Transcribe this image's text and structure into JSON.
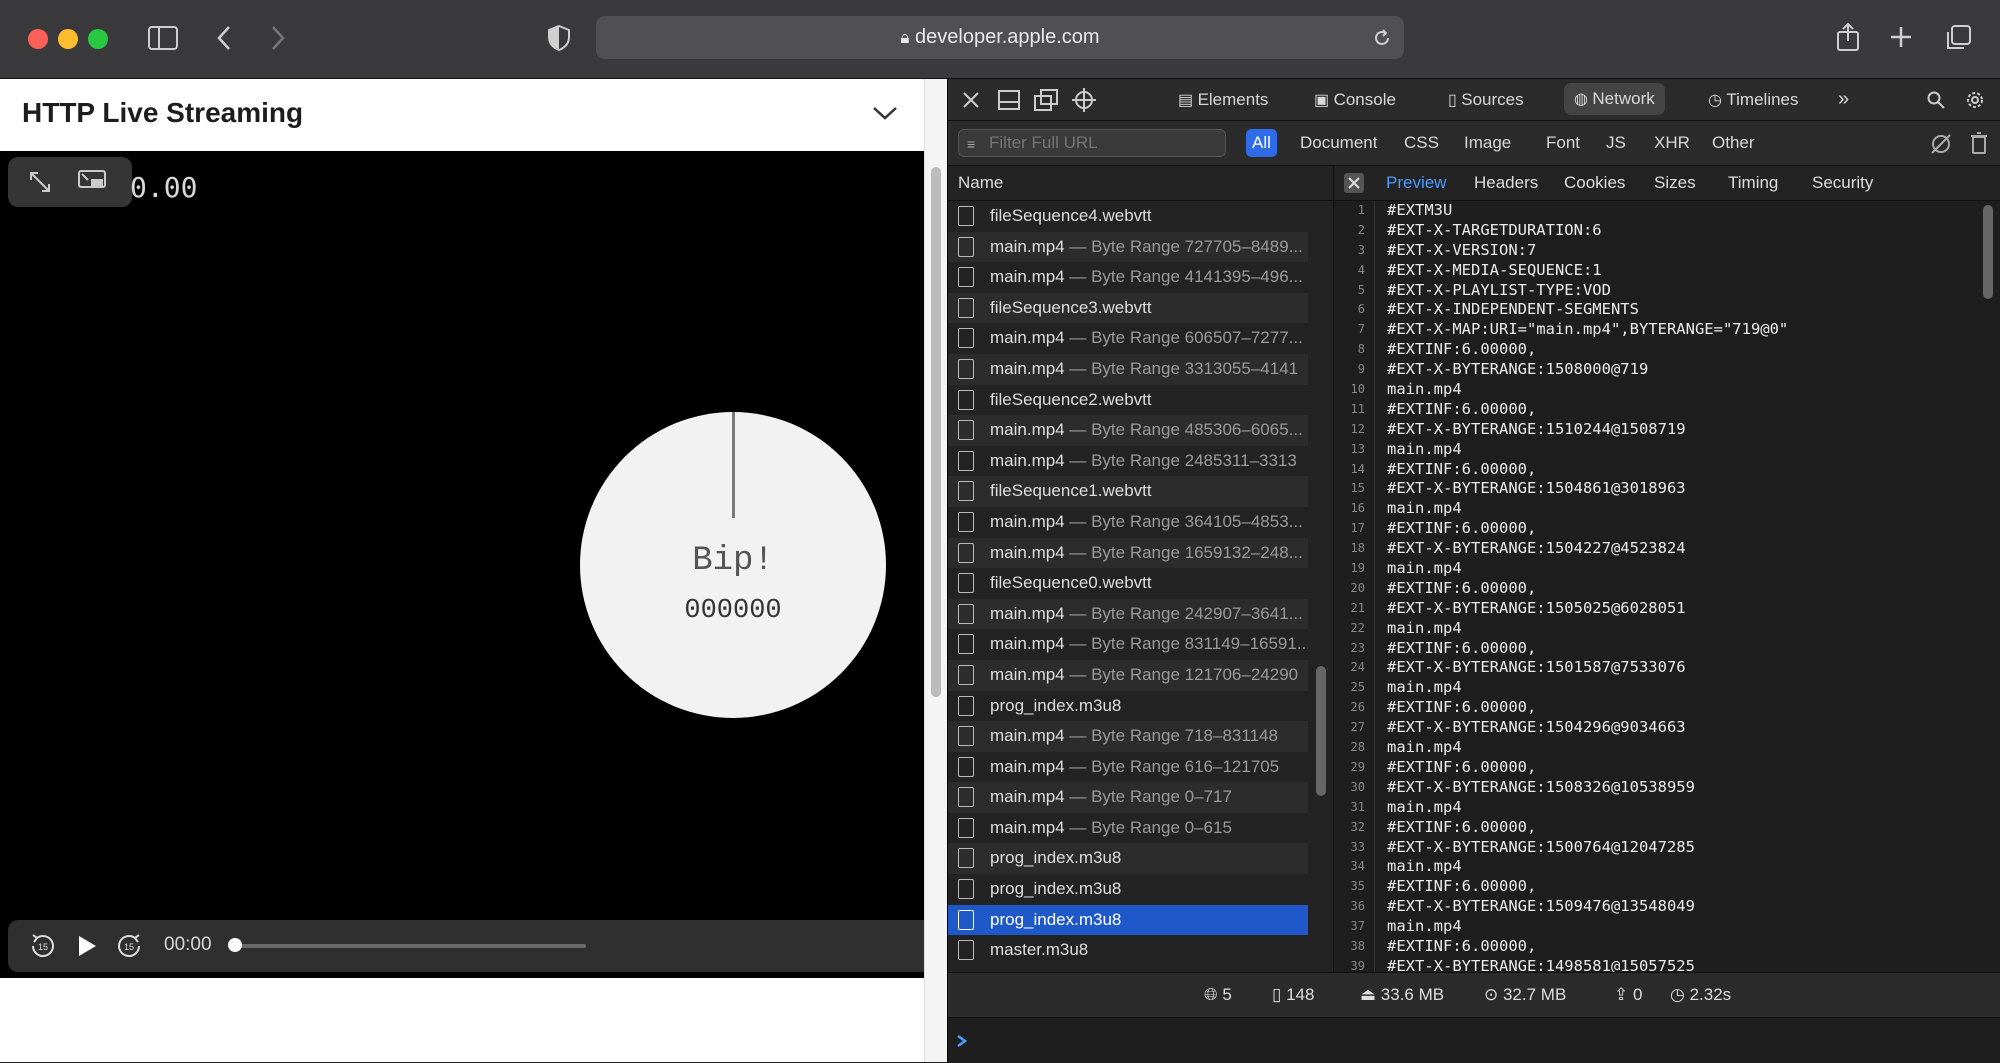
{
  "browser": {
    "url": "developer.apple.com",
    "colors": {
      "close": "#fe5f57",
      "minimize": "#febc2e",
      "zoom": "#28c840"
    }
  },
  "page": {
    "title": "HTTP Live Streaming",
    "video": {
      "top_time": "0.00",
      "bip_text": "Bip!",
      "counter": "000000",
      "current_time": "00:00"
    }
  },
  "devtools": {
    "tabs": [
      "Elements",
      "Console",
      "Sources",
      "Network",
      "Timelines"
    ],
    "active_tab": "Network",
    "filter": {
      "placeholder": "Filter Full URL"
    },
    "types": [
      "All",
      "Document",
      "CSS",
      "Image",
      "Font",
      "JS",
      "XHR",
      "Other"
    ],
    "active_type": "All",
    "name_header": "Name",
    "requests": [
      {
        "name": "fileSequence4.webvtt",
        "range": ""
      },
      {
        "name": "main.mp4",
        "range": " — Byte Range 727705–8489..."
      },
      {
        "name": "main.mp4",
        "range": " — Byte Range 4141395–496..."
      },
      {
        "name": "fileSequence3.webvtt",
        "range": ""
      },
      {
        "name": "main.mp4",
        "range": " — Byte Range 606507–7277..."
      },
      {
        "name": "main.mp4",
        "range": " — Byte Range 3313055–4141"
      },
      {
        "name": "fileSequence2.webvtt",
        "range": ""
      },
      {
        "name": "main.mp4",
        "range": " — Byte Range 485306–6065..."
      },
      {
        "name": "main.mp4",
        "range": " — Byte Range 2485311–3313"
      },
      {
        "name": "fileSequence1.webvtt",
        "range": ""
      },
      {
        "name": "main.mp4",
        "range": " — Byte Range 364105–4853..."
      },
      {
        "name": "main.mp4",
        "range": " — Byte Range 1659132–248..."
      },
      {
        "name": "fileSequence0.webvtt",
        "range": ""
      },
      {
        "name": "main.mp4",
        "range": " — Byte Range 242907–3641..."
      },
      {
        "name": "main.mp4",
        "range": " — Byte Range 831149–16591..."
      },
      {
        "name": "main.mp4",
        "range": " — Byte Range 121706–24290"
      },
      {
        "name": "prog_index.m3u8",
        "range": ""
      },
      {
        "name": "main.mp4",
        "range": " — Byte Range 718–831148"
      },
      {
        "name": "main.mp4",
        "range": " — Byte Range 616–121705"
      },
      {
        "name": "main.mp4",
        "range": " — Byte Range 0–717"
      },
      {
        "name": "main.mp4",
        "range": " — Byte Range 0–615"
      },
      {
        "name": "prog_index.m3u8",
        "range": ""
      },
      {
        "name": "prog_index.m3u8",
        "range": ""
      },
      {
        "name": "prog_index.m3u8",
        "range": ""
      },
      {
        "name": "master.m3u8",
        "range": ""
      }
    ],
    "selected_request": 23,
    "preview_tabs": [
      "Preview",
      "Headers",
      "Cookies",
      "Sizes",
      "Timing",
      "Security"
    ],
    "active_preview_tab": "Preview",
    "code_lines": [
      "#EXTM3U",
      "#EXT-X-TARGETDURATION:6",
      "#EXT-X-VERSION:7",
      "#EXT-X-MEDIA-SEQUENCE:1",
      "#EXT-X-PLAYLIST-TYPE:VOD",
      "#EXT-X-INDEPENDENT-SEGMENTS",
      "#EXT-X-MAP:URI=\"main.mp4\",BYTERANGE=\"719@0\"",
      "#EXTINF:6.00000,",
      "#EXT-X-BYTERANGE:1508000@719",
      "main.mp4",
      "#EXTINF:6.00000,",
      "#EXT-X-BYTERANGE:1510244@1508719",
      "main.mp4",
      "#EXTINF:6.00000,",
      "#EXT-X-BYTERANGE:1504861@3018963",
      "main.mp4",
      "#EXTINF:6.00000,",
      "#EXT-X-BYTERANGE:1504227@4523824",
      "main.mp4",
      "#EXTINF:6.00000,",
      "#EXT-X-BYTERANGE:1505025@6028051",
      "main.mp4",
      "#EXTINF:6.00000,",
      "#EXT-X-BYTERANGE:1501587@7533076",
      "main.mp4",
      "#EXTINF:6.00000,",
      "#EXT-X-BYTERANGE:1504296@9034663",
      "main.mp4",
      "#EXTINF:6.00000,",
      "#EXT-X-BYTERANGE:1508326@10538959",
      "main.mp4",
      "#EXTINF:6.00000,",
      "#EXT-X-BYTERANGE:1500764@12047285",
      "main.mp4",
      "#EXTINF:6.00000,",
      "#EXT-X-BYTERANGE:1509476@13548049",
      "main.mp4",
      "#EXTINF:6.00000,",
      "#EXT-X-BYTERANGE:1498581@15057525"
    ],
    "status": {
      "domains": "5",
      "requests": "148",
      "transferred": "33.6 MB",
      "resources": "32.7 MB",
      "redirects": "0",
      "time": "2.32s"
    }
  }
}
